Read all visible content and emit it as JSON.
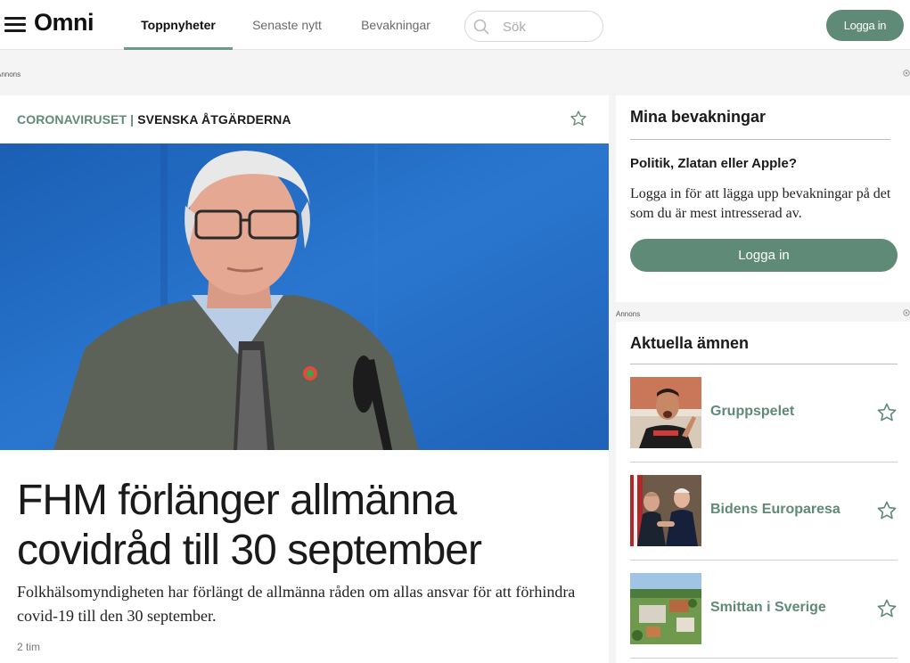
{
  "header": {
    "logo": "Omni",
    "tabs": [
      {
        "label": "Toppnyheter",
        "active": true
      },
      {
        "label": "Senaste nytt",
        "active": false
      },
      {
        "label": "Bevakningar",
        "active": false
      }
    ],
    "search_placeholder": "Sök",
    "login_label": "Logga in"
  },
  "ads": {
    "label_top": "Annons",
    "label_side": "Annons"
  },
  "article": {
    "topic": "CORONAVIRUSET",
    "separator": "|",
    "subtopic": "SVENSKA ÅTGÄRDERNA",
    "headline": "FHM förlänger allmänna covidråd till 30 september",
    "lead": "Folkhälsomyndigheten har förlängt de allmänna råden om allas ansvar för att förhindra covid-19 till den 30 september.",
    "time": "2 tim"
  },
  "watchlist": {
    "title": "Mina bevakningar",
    "question": "Politik, Zlatan eller Apple?",
    "text": "Logga in för att lägga upp bevakningar på det som du är mest intresserad av.",
    "login_label": "Logga in"
  },
  "current_topics": {
    "title": "Aktuella ämnen",
    "items": [
      {
        "name": "Gruppspelet"
      },
      {
        "name": "Bidens Europaresa"
      },
      {
        "name": "Smittan i Sverige"
      }
    ]
  },
  "colors": {
    "accent": "#5f8a77",
    "background": "#f4f4f4"
  }
}
